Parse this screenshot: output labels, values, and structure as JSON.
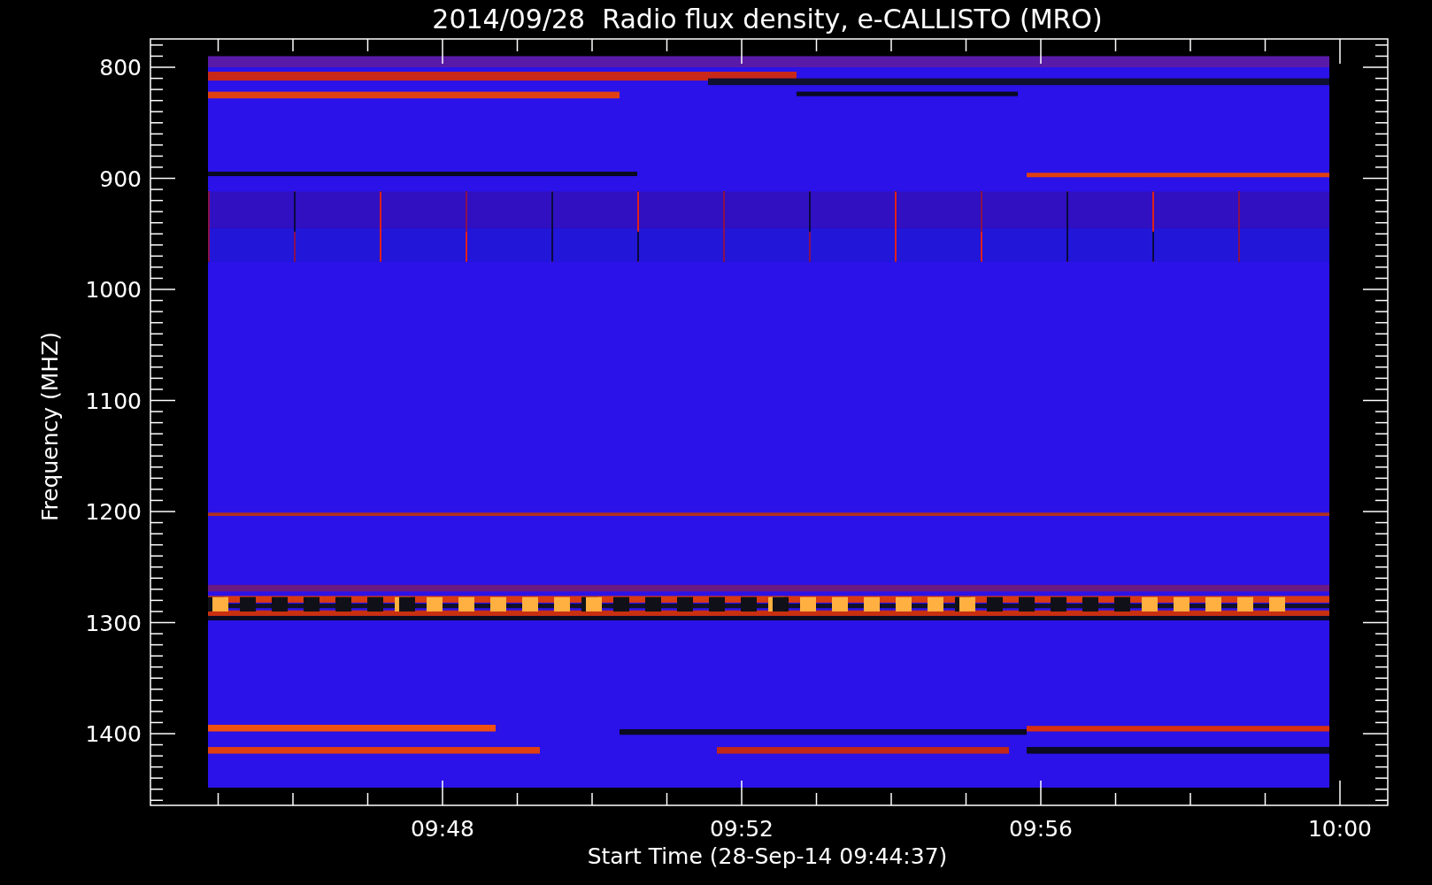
{
  "title": "2014/09/28  Radio flux density, e-CALLISTO (MRO)",
  "plot": {
    "ylabel": "Frequency (MHZ)",
    "yticks": [
      "800",
      "900",
      "1000",
      "1100",
      "1200",
      "1300",
      "1400"
    ],
    "xticks": [
      "09:48",
      "09:52",
      "09:56",
      "10:00"
    ],
    "xlabel": "Start Time (28-Sep-14 09:44:37)"
  }
}
